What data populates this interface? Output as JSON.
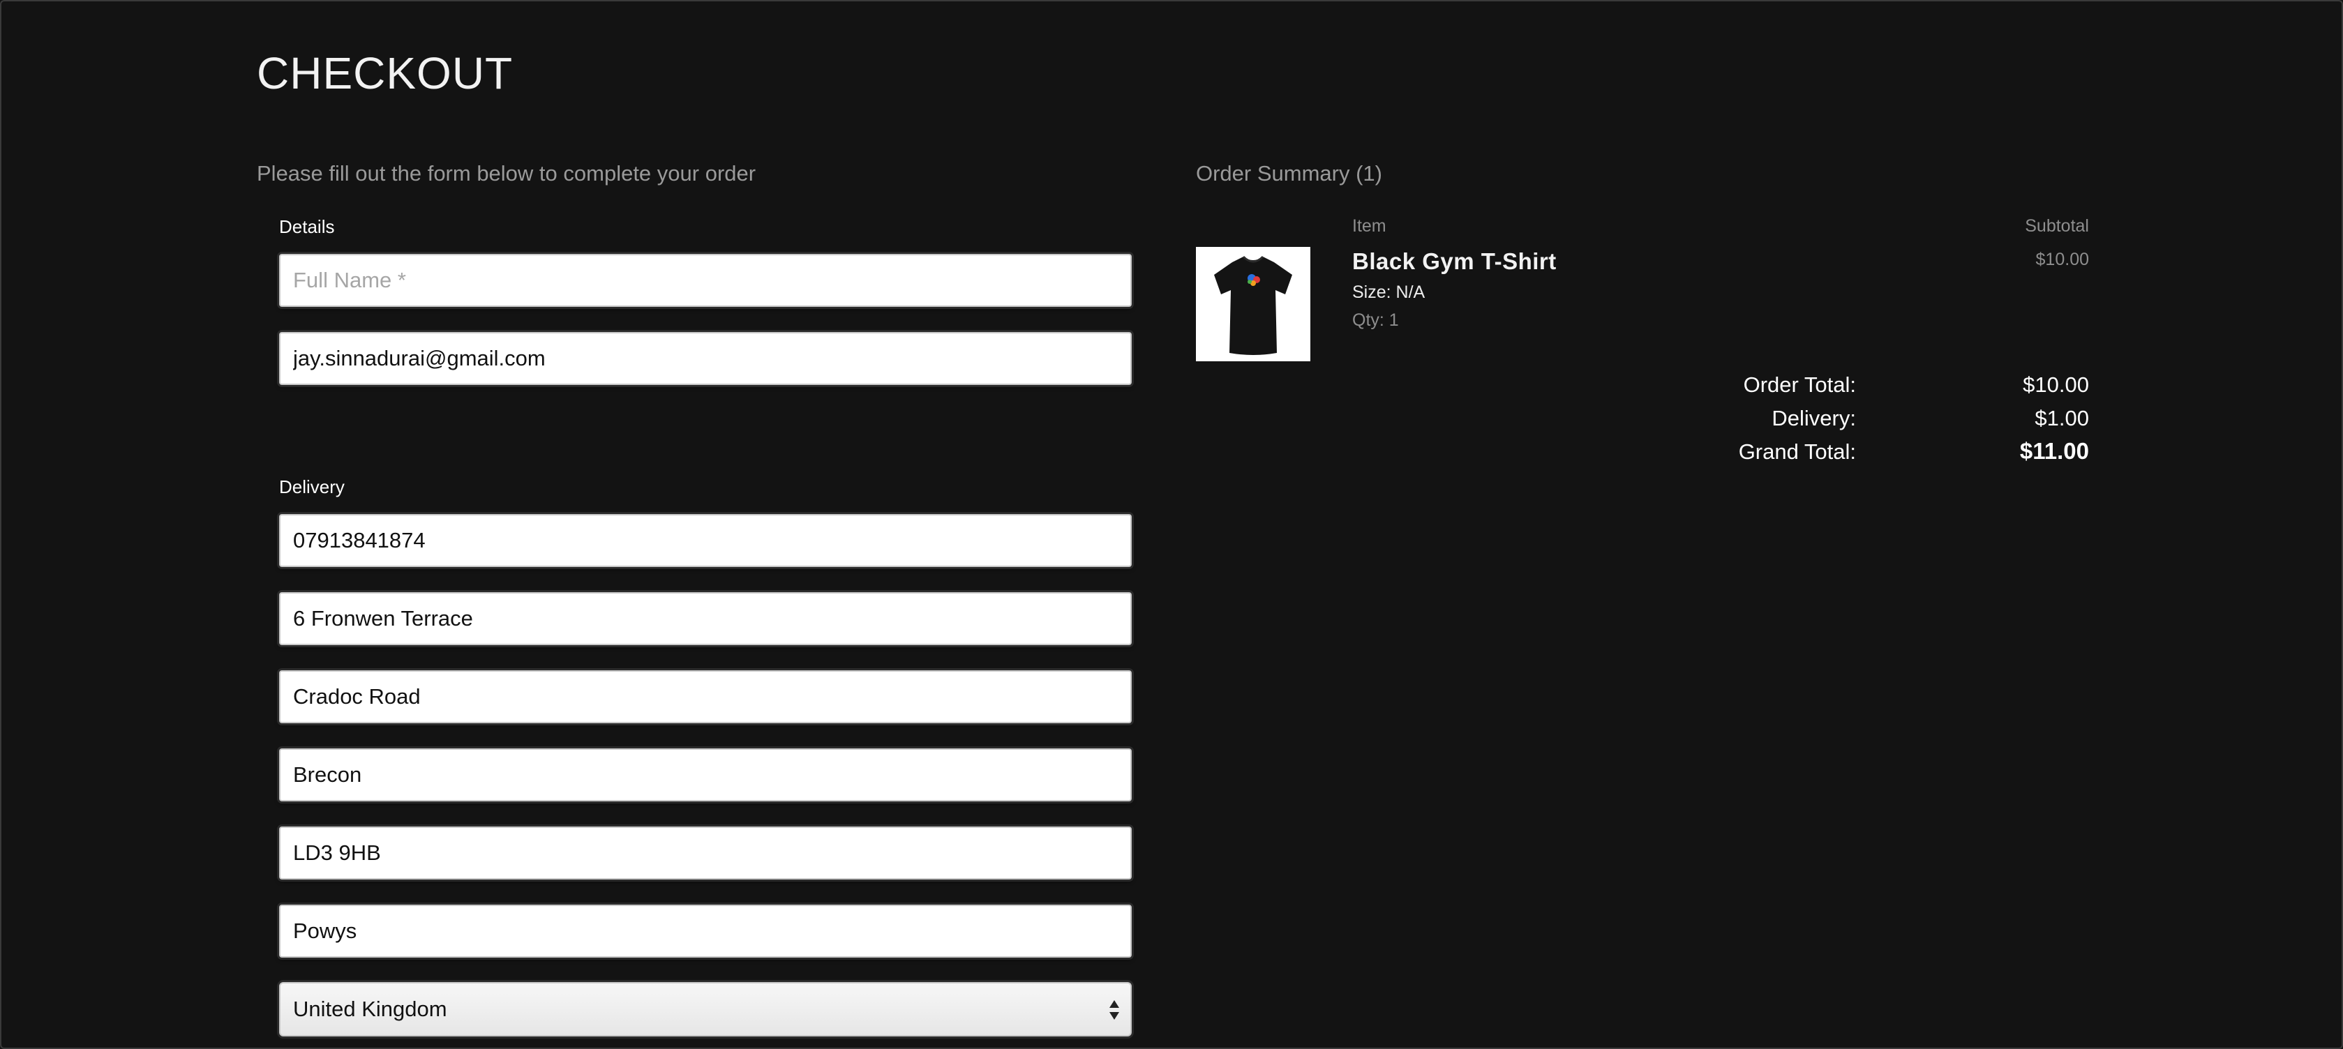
{
  "page": {
    "title": "CHECKOUT",
    "intro": "Please fill out the form below to complete your order"
  },
  "form": {
    "details_label": "Details",
    "full_name": {
      "value": "",
      "placeholder": "Full Name *"
    },
    "email": {
      "value": "jay.sinnadurai@gmail.com"
    },
    "delivery_label": "Delivery",
    "phone": {
      "value": "07913841874"
    },
    "address_line_1": {
      "value": "6 Fronwen Terrace"
    },
    "address_line_2": {
      "value": "Cradoc Road"
    },
    "town": {
      "value": "Brecon"
    },
    "postcode": {
      "value": "LD3 9HB"
    },
    "county": {
      "value": "Powys"
    },
    "country": {
      "selected": "United Kingdom"
    }
  },
  "summary": {
    "title": "Order Summary (1)",
    "item_header": "Item",
    "subtotal_header": "Subtotal",
    "items": [
      {
        "name": "Black Gym T-Shirt",
        "size": "Size: N/A",
        "qty": "Qty: 1",
        "subtotal": "$10.00",
        "image_icon": "black-tshirt-image"
      }
    ],
    "order_total_label": "Order Total:",
    "order_total": "$10.00",
    "delivery_label": "Delivery:",
    "delivery": "$1.00",
    "grand_total_label": "Grand Total:",
    "grand_total": "$11.00"
  },
  "colors": {
    "background": "#131313",
    "muted_text": "#9a9a9a",
    "field_background": "#ffffff"
  }
}
